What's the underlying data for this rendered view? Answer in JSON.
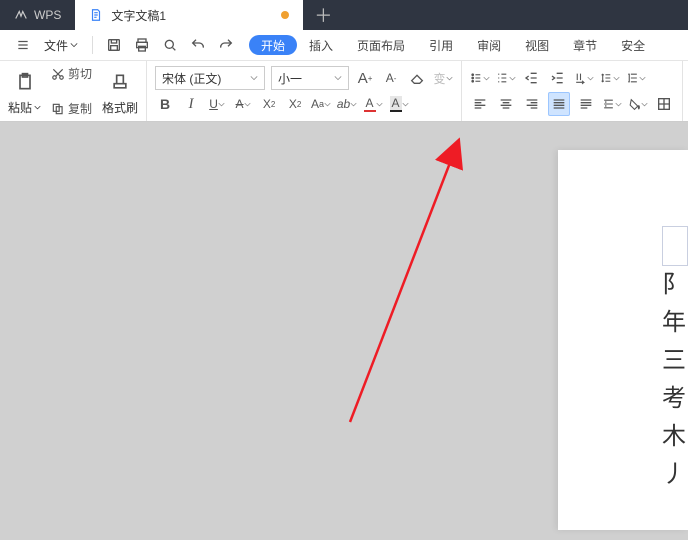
{
  "titlebar": {
    "app": "WPS",
    "doc_tab": "文字文稿1"
  },
  "menubar": {
    "file": "文件",
    "tabs": [
      "开始",
      "插入",
      "页面布局",
      "引用",
      "审阅",
      "视图",
      "章节",
      "安全"
    ]
  },
  "clipboard": {
    "cut": "剪切",
    "copy": "复制",
    "paste": "粘贴",
    "format_brush": "格式刷"
  },
  "font": {
    "name": "宋体 (正文)",
    "size": "小一",
    "bold": "B",
    "italic": "I",
    "underline": "U",
    "aa_big": "A",
    "aa_small": "A",
    "sup": "X²",
    "sub": "X₂",
    "a_font": "A",
    "clear_fmt": "◈",
    "color_a": "A",
    "highlight_a": "A"
  },
  "para": {
    "bullets": "•",
    "numbers": "≡",
    "dec_indent": "⇤",
    "inc_indent": "⇥"
  },
  "page": {
    "lines": [
      "阝",
      "年",
      "三",
      "考",
      "木",
      "丿"
    ]
  }
}
